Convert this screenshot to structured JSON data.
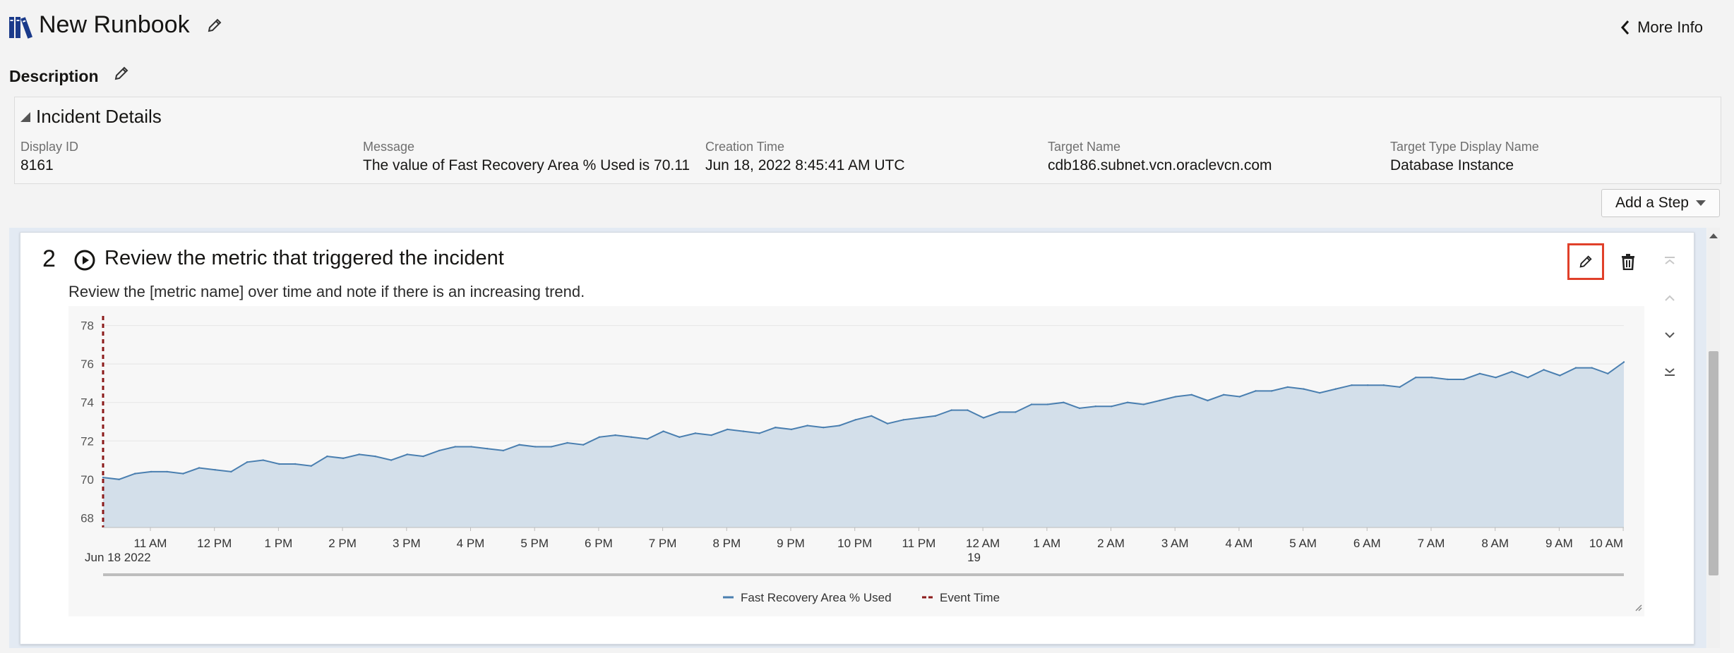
{
  "header": {
    "title": "New Runbook",
    "more_info_label": "More Info"
  },
  "description": {
    "label": "Description"
  },
  "incident": {
    "heading": "Incident Details",
    "fields": [
      {
        "label": "Display ID",
        "value": "8161"
      },
      {
        "label": "Message",
        "value": "The value of Fast Recovery Area % Used is 70.11"
      },
      {
        "label": "Creation Time",
        "value": "Jun 18, 2022 8:45:41 AM UTC"
      },
      {
        "label": "Target Name",
        "value": "cdb186.subnet.vcn.oraclevcn.com"
      },
      {
        "label": "Target Type Display Name",
        "value": "Database Instance"
      }
    ]
  },
  "toolbar": {
    "add_step_label": "Add a Step"
  },
  "step": {
    "number": "2",
    "title": "Review the metric that triggered the incident",
    "description": "Review the [metric name] over time and note if there is an increasing trend."
  },
  "chart_data": {
    "type": "area",
    "xlabel": "",
    "ylabel": "",
    "ylim": [
      67.5,
      78.5
    ],
    "y_ticks": [
      "68",
      "70",
      "72",
      "74",
      "76",
      "78"
    ],
    "x_ticks": [
      {
        "label": "11 AM",
        "sub": "Jun 18 2022"
      },
      {
        "label": "12 PM",
        "sub": ""
      },
      {
        "label": "1 PM",
        "sub": ""
      },
      {
        "label": "2 PM",
        "sub": ""
      },
      {
        "label": "3 PM",
        "sub": ""
      },
      {
        "label": "4 PM",
        "sub": ""
      },
      {
        "label": "5 PM",
        "sub": ""
      },
      {
        "label": "6 PM",
        "sub": ""
      },
      {
        "label": "7 PM",
        "sub": ""
      },
      {
        "label": "8 PM",
        "sub": ""
      },
      {
        "label": "9 PM",
        "sub": ""
      },
      {
        "label": "10 PM",
        "sub": ""
      },
      {
        "label": "11 PM",
        "sub": ""
      },
      {
        "label": "12 AM",
        "sub": "19"
      },
      {
        "label": "1 AM",
        "sub": ""
      },
      {
        "label": "2 AM",
        "sub": ""
      },
      {
        "label": "3 AM",
        "sub": ""
      },
      {
        "label": "4 AM",
        "sub": ""
      },
      {
        "label": "5 AM",
        "sub": ""
      },
      {
        "label": "6 AM",
        "sub": ""
      },
      {
        "label": "7 AM",
        "sub": ""
      },
      {
        "label": "8 AM",
        "sub": ""
      },
      {
        "label": "9 AM",
        "sub": ""
      },
      {
        "label": "10 AM",
        "sub": ""
      }
    ],
    "series": [
      {
        "name": "Fast Recovery Area % Used",
        "color": "#4a7fb0",
        "fill": "#d3dfea",
        "values": [
          70.1,
          70.0,
          70.3,
          70.4,
          70.4,
          70.3,
          70.6,
          70.5,
          70.4,
          70.9,
          71.0,
          70.8,
          70.8,
          70.7,
          71.2,
          71.1,
          71.3,
          71.2,
          71.0,
          71.3,
          71.2,
          71.5,
          71.7,
          71.7,
          71.6,
          71.5,
          71.8,
          71.7,
          71.7,
          71.9,
          71.8,
          72.2,
          72.3,
          72.2,
          72.1,
          72.5,
          72.2,
          72.4,
          72.3,
          72.6,
          72.5,
          72.4,
          72.7,
          72.6,
          72.8,
          72.7,
          72.8,
          73.1,
          73.3,
          72.9,
          73.1,
          73.2,
          73.3,
          73.6,
          73.6,
          73.2,
          73.5,
          73.5,
          73.9,
          73.9,
          74.0,
          73.7,
          73.8,
          73.8,
          74.0,
          73.9,
          74.1,
          74.3,
          74.4,
          74.1,
          74.4,
          74.3,
          74.6,
          74.6,
          74.8,
          74.7,
          74.5,
          74.7,
          74.9,
          74.9,
          74.9,
          74.8,
          75.3,
          75.3,
          75.2,
          75.2,
          75.5,
          75.3,
          75.6,
          75.3,
          75.7,
          75.4,
          75.8,
          75.8,
          75.5,
          76.1
        ]
      },
      {
        "name": "Event Time",
        "color": "#8b1a1a",
        "type": "event-marker",
        "x_position": "start"
      }
    ],
    "legend": [
      "Fast Recovery Area % Used",
      "Event Time"
    ],
    "legend_position": "bottom-center",
    "grid": true
  }
}
